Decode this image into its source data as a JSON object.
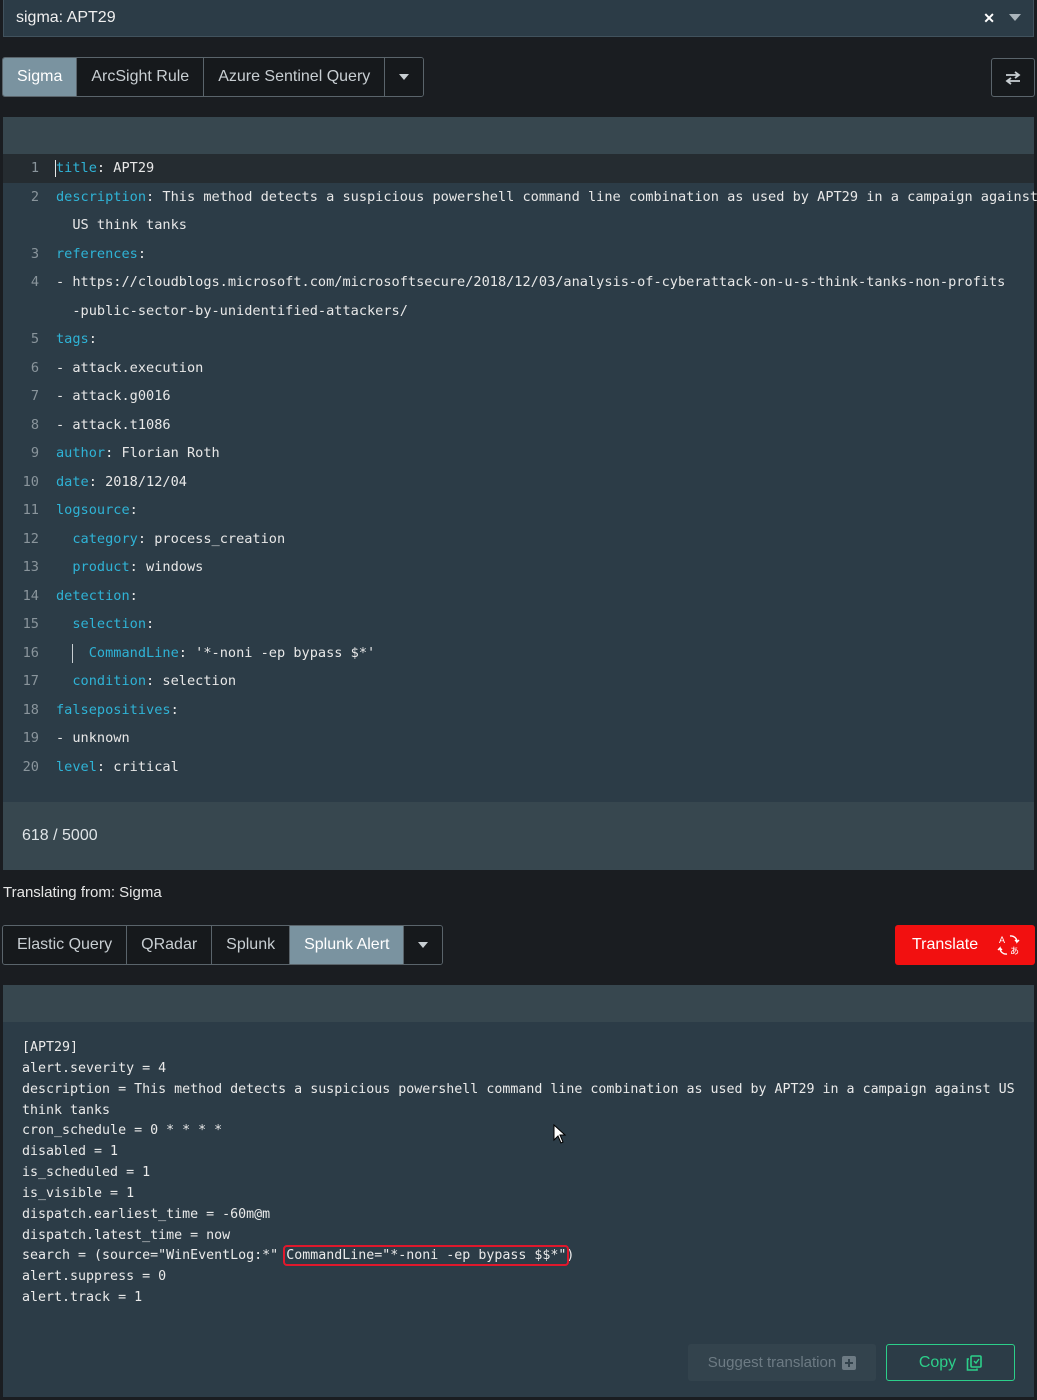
{
  "selector": {
    "value": "sigma: APT29"
  },
  "source_tabs": {
    "items": [
      "Sigma",
      "ArcSight Rule",
      "Azure Sentinel Query"
    ],
    "active": "Sigma"
  },
  "editor": {
    "lines": [
      {
        "n": "1",
        "key": "title",
        "rest": ": APT29"
      },
      {
        "n": "2",
        "key": "description",
        "rest": ": This method detects a suspicious powershell command line combination as used by APT29 in a campaign against"
      },
      {
        "n": "",
        "text": "  US think tanks"
      },
      {
        "n": "3",
        "key": "references",
        "rest": ":"
      },
      {
        "n": "4",
        "text": "- https://cloudblogs.microsoft.com/microsoftsecure/2018/12/03/analysis-of-cyberattack-on-u-s-think-tanks-non-profits"
      },
      {
        "n": "",
        "text": "  -public-sector-by-unidentified-attackers/"
      },
      {
        "n": "5",
        "key": "tags",
        "rest": ":"
      },
      {
        "n": "6",
        "text": "- attack.execution"
      },
      {
        "n": "7",
        "text": "- attack.g0016"
      },
      {
        "n": "8",
        "text": "- attack.t1086"
      },
      {
        "n": "9",
        "key": "author",
        "rest": ": Florian Roth"
      },
      {
        "n": "10",
        "key": "date",
        "rest": ": 2018/12/04"
      },
      {
        "n": "11",
        "key": "logsource",
        "rest": ":"
      },
      {
        "n": "12",
        "indent": "  ",
        "key": "category",
        "rest": ": process_creation"
      },
      {
        "n": "13",
        "indent": "  ",
        "key": "product",
        "rest": ": windows"
      },
      {
        "n": "14",
        "key": "detection",
        "rest": ":"
      },
      {
        "n": "15",
        "indent": "  ",
        "key": "selection",
        "rest": ":"
      },
      {
        "n": "16",
        "indent": "    ",
        "key": "CommandLine",
        "rest": ": '*-noni -ep bypass $*'"
      },
      {
        "n": "17",
        "indent": "  ",
        "key": "condition",
        "rest": ": selection"
      },
      {
        "n": "18",
        "key": "falsepositives",
        "rest": ":"
      },
      {
        "n": "19",
        "text": "- unknown"
      },
      {
        "n": "20",
        "key": "level",
        "rest": ": critical"
      }
    ],
    "counter": "618 / 5000"
  },
  "translating_from": "Translating from: Sigma",
  "target_tabs": {
    "items": [
      "Elastic Query",
      "QRadar",
      "Splunk",
      "Splunk Alert"
    ],
    "active": "Splunk Alert"
  },
  "translate_button": {
    "label": "Translate"
  },
  "output": {
    "lines": [
      "[APT29]",
      "alert.severity = 4",
      "description = This method detects a suspicious powershell command line combination as used by APT29 in a campaign against US think tanks",
      "cron_schedule = 0 * * * *",
      "disabled = 1",
      "is_scheduled = 1",
      "is_visible = 1",
      "dispatch.earliest_time = -60m@m",
      "dispatch.latest_time = now"
    ],
    "search_prefix": "search = (source=\"WinEventLog:*\" ",
    "search_highlight": "CommandLine=\"*-noni -ep bypass $$*\"",
    "search_suffix": ")",
    "tail_lines": [
      "alert.suppress = 0",
      "alert.track = 1"
    ]
  },
  "suggest_button": {
    "label": "Suggest translation"
  },
  "copy_button": {
    "label": "Copy"
  },
  "colors": {
    "accent_red": "#f21010",
    "accent_green": "#2ccf8a",
    "yaml_key": "#2fb3d6"
  }
}
